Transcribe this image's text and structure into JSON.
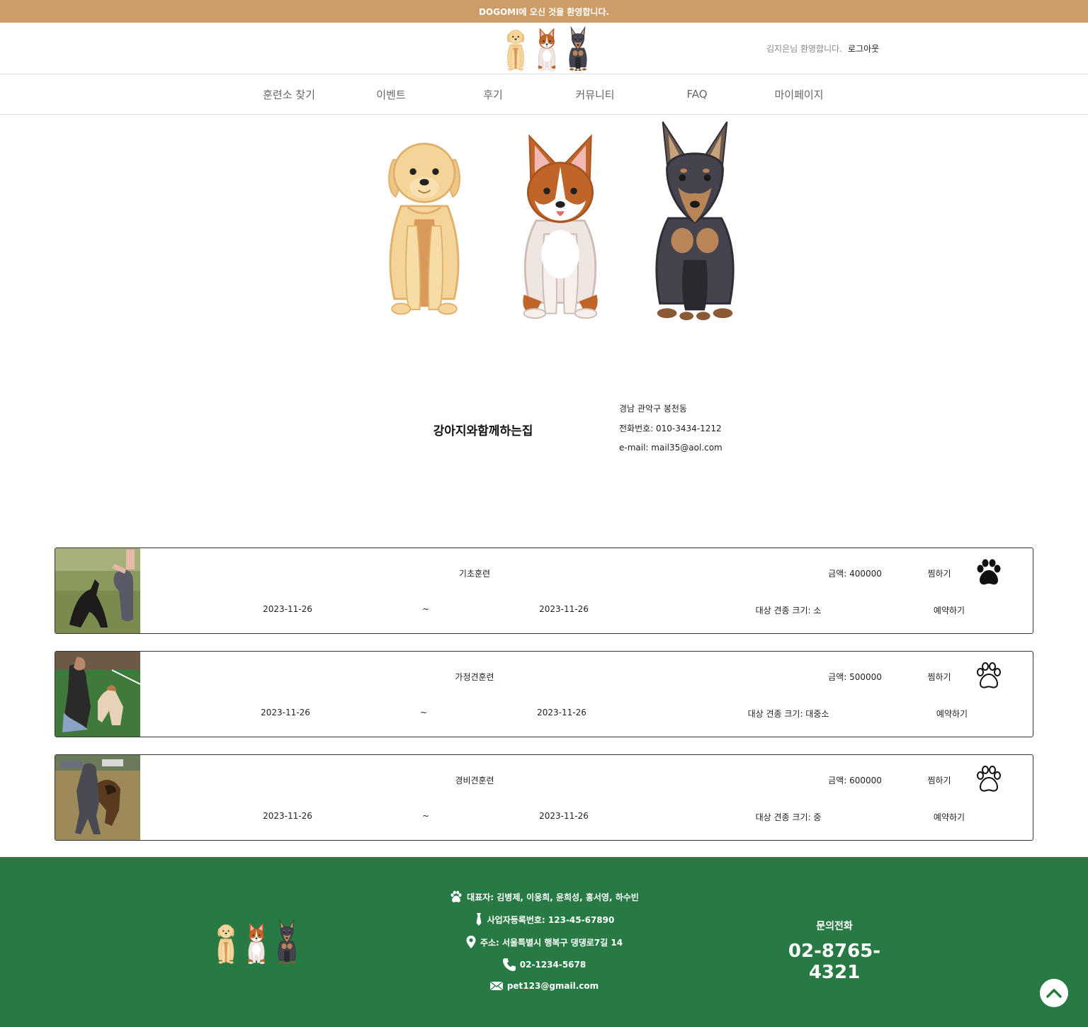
{
  "announcement": "DOGOMI에 오신 것을 환영합니다.",
  "header": {
    "logo_icon": "three-dogs-logo",
    "greeting": "김지은님 환영합니다.",
    "logout_label": "로그아웃"
  },
  "nav": {
    "items": [
      {
        "label": "훈련소 찾기"
      },
      {
        "label": "이벤트"
      },
      {
        "label": "후기"
      },
      {
        "label": "커뮤니티"
      },
      {
        "label": "FAQ"
      },
      {
        "label": "마이페이지"
      }
    ]
  },
  "center": {
    "name": "강아지와함께하는집",
    "address": "경남 관악구 봉천동",
    "phone": "전화번호: 010-3434-1212",
    "email": "e-mail: mail35@aol.com"
  },
  "programs": [
    {
      "title": "기초훈련",
      "price": "금액: 400000",
      "wishlist_label": "찜하기",
      "wishlisted": true,
      "start_date": "2023-11-26",
      "separator": "~",
      "end_date": "2023-11-26",
      "size": "대상 견종 크기: 소",
      "reserve_label": "예약하기",
      "photo": "dog-training-photo"
    },
    {
      "title": "가정견훈련",
      "price": "금액: 500000",
      "wishlist_label": "찜하기",
      "wishlisted": false,
      "start_date": "2023-11-26",
      "separator": "~",
      "end_date": "2023-11-26",
      "size": "대상 견종 크기: 대중소",
      "reserve_label": "예약하기",
      "photo": "dog-training-photo"
    },
    {
      "title": "경비견훈련",
      "price": "금액: 600000",
      "wishlist_label": "찜하기",
      "wishlisted": false,
      "start_date": "2023-11-26",
      "separator": "~",
      "end_date": "2023-11-26",
      "size": "대상 견종 크기: 중",
      "reserve_label": "예약하기",
      "photo": "dog-training-photo"
    }
  ],
  "footer": {
    "representatives": "대표자: 김병제, 이웅희, 윤희성, 홍서영, 하수빈",
    "business_number": "사업자등록번호: 123-45-67890",
    "address": "주소: 서울특별시 행복구 댕댕로7길 14",
    "phone": "02-1234-5678",
    "email": "pet123@gmail.com",
    "contact_title": "문의전화",
    "contact_phone": "02-8765-4321"
  },
  "colors": {
    "announcement_bg": "#cc9d68",
    "footer_bg": "#277a43"
  }
}
